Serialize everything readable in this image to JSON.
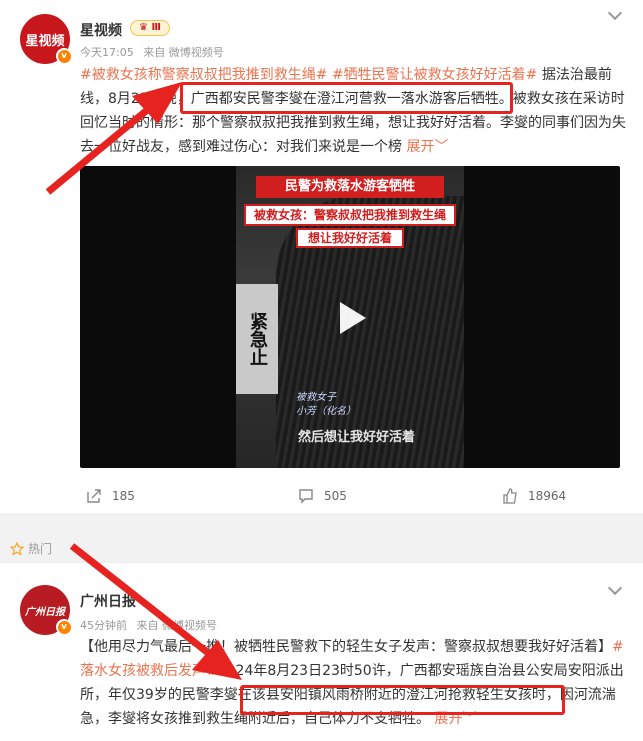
{
  "post1": {
    "author": "星视频",
    "avatar_text": "星视频",
    "badge": "Ⅲ",
    "time": "今天17:05",
    "source": "来自 微博视频号",
    "text": {
      "topic1": "#被救女孩称警察叔叔把我推到救生绳#",
      "topic2": "#牺牲民警让被救女孩好好活着#",
      "part1": " 据法治最前线，8月23日晚，",
      "highlight": "广西都安民警李燮在澄江河营救一落水游客后牺牲。",
      "part2": "被救女孩在采访时回忆当时的情形：那个警察叔叔把我推到救生绳，想让我好好活着。李燮的同事们因为失去一位好战友，感到难过伤心：对我们来说是一个榜",
      "more": "展开"
    },
    "video": {
      "title1": "民警为救落水游客牺牲",
      "title2": "被救女孩：警察叔叔把我推到救生绳",
      "title3": "想让我好好活着",
      "sign": "紧急止",
      "caption_role": "被救女子",
      "caption_name": "小芳（化名）",
      "subtitle": "然后想让我好好活着"
    },
    "actions": {
      "share": "185",
      "comment": "505",
      "like": "18964"
    }
  },
  "hot_label": "热门",
  "post2": {
    "author": "广州日报",
    "avatar_text": "广州日报",
    "time": "45分钟前",
    "source": "来自 微博视频号",
    "text": {
      "part1": "【他用尽力气最后一推！被牺牲民警救下的轻生女子发声：警察叔叔想要我好好活着】",
      "topic": "#落水女孩被救后发声#",
      "part2": "2024年8月23日23时50许，广西都安瑶族自治县公安局安阳派出所，年仅39岁的民警李燮",
      "highlight": "在该县安阳镇风雨桥附近的澄江河抢救轻生女孩时",
      "part3": "，因河流湍急，李燮将女孩推到救生绳附近后，自己体力不支牺牲。",
      "more": "展开"
    }
  },
  "colors": {
    "accent": "#eb7350",
    "annotation": "#e6231f",
    "verified": "#ff8200"
  }
}
